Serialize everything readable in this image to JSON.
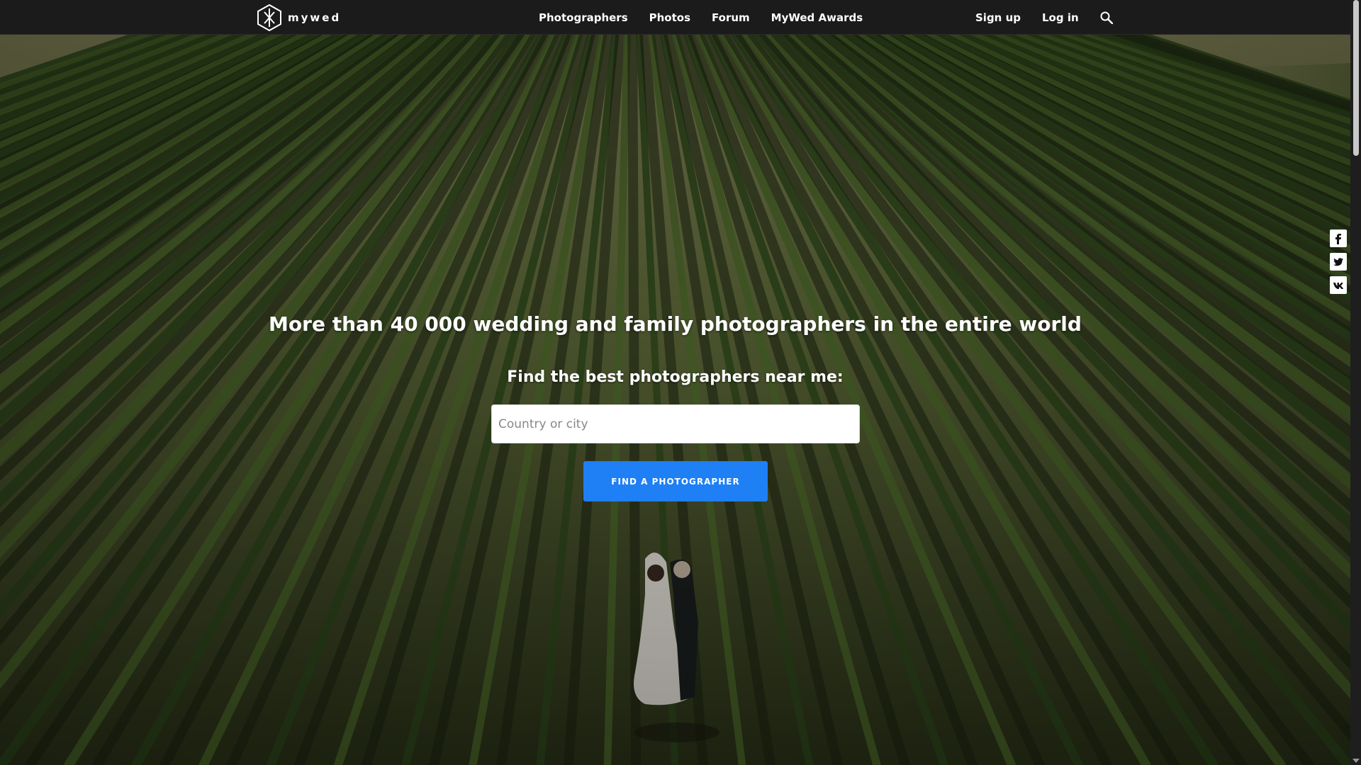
{
  "header": {
    "logo_text": "mywed",
    "nav": [
      {
        "label": "Photographers"
      },
      {
        "label": "Photos"
      },
      {
        "label": "Forum"
      },
      {
        "label": "MyWed Awards"
      }
    ],
    "sign_up": "Sign up",
    "log_in": "Log in",
    "search_icon": "search-icon"
  },
  "hero": {
    "headline": "More than 40 000 wedding and family photographers in the entire world",
    "subline": "Find the best photographers near me:",
    "search": {
      "placeholder": "Country or city",
      "value": ""
    },
    "button_label": "FIND A PHOTOGRAPHER"
  },
  "social": [
    {
      "icon": "facebook-icon"
    },
    {
      "icon": "twitter-icon"
    },
    {
      "icon": "vk-icon"
    }
  ],
  "colors": {
    "header_bg": "#1b1b1b",
    "button_blue": "#1f7ff5",
    "text_white": "#ffffff"
  }
}
